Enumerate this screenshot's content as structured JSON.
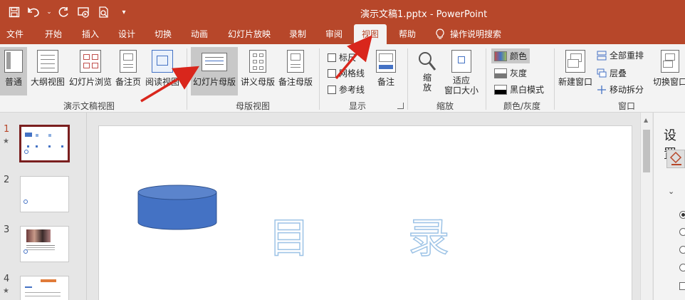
{
  "app": {
    "doc_title": "演示文稿1.pptx  -  PowerPoint"
  },
  "tabs": [
    "文件",
    "开始",
    "插入",
    "设计",
    "切换",
    "动画",
    "幻灯片放映",
    "录制",
    "审阅",
    "视图",
    "帮助"
  ],
  "active_tab": "视图",
  "search_label": "操作说明搜索",
  "ribbon": {
    "presentation_views": {
      "label": "演示文稿视图",
      "buttons": [
        "普通",
        "大纲视图",
        "幻灯片浏览",
        "备注页",
        "阅读视图"
      ]
    },
    "master_views": {
      "label": "母版视图",
      "buttons": [
        "幻灯片母版",
        "讲义母版",
        "备注母版"
      ]
    },
    "show": {
      "label": "显示",
      "checks": [
        "标尺",
        "网格线",
        "参考线"
      ],
      "notes": "备注"
    },
    "zoom": {
      "label": "缩放",
      "zoom_btn": "缩\n放",
      "zoom_btn_line1": "缩",
      "zoom_btn_line2": "放",
      "fit_line1": "适应",
      "fit_line2": "窗口大小"
    },
    "color": {
      "label": "颜色/灰度",
      "options": [
        "颜色",
        "灰度",
        "黑白模式"
      ]
    },
    "window": {
      "label": "窗口",
      "new_window": "新建窗口",
      "arrange_all": "全部重排",
      "cascade": "层叠",
      "move_split": "移动拆分",
      "switch_window": "切换窗口"
    }
  },
  "slides": {
    "numbers": [
      "1",
      "2",
      "3",
      "4"
    ]
  },
  "slide_content": {
    "title_chars": [
      "目",
      "录"
    ]
  },
  "pane": {
    "title": "设置"
  },
  "colors": {
    "accent": "#b7472a",
    "shape_fill": "#4472c4"
  }
}
